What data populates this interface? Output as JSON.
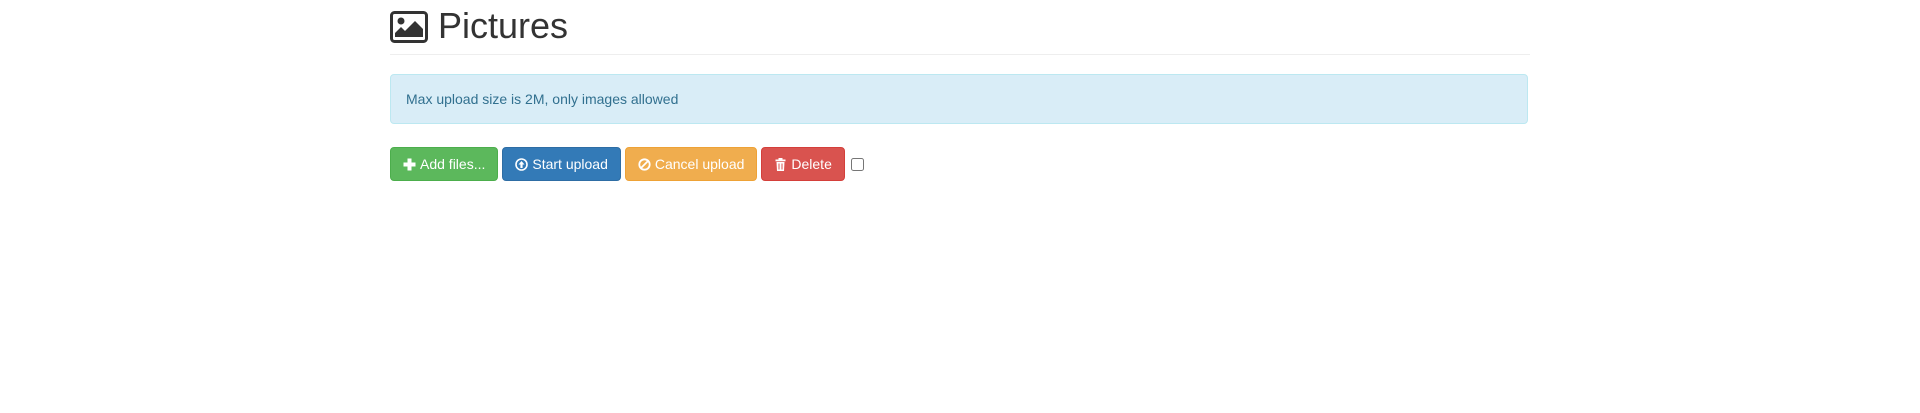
{
  "header": {
    "title": "Pictures",
    "icon": "picture-icon"
  },
  "alert": {
    "text": "Max upload size is 2M, only images allowed"
  },
  "toolbar": {
    "add_files_label": "Add files...",
    "start_upload_label": "Start upload",
    "cancel_upload_label": "Cancel upload",
    "delete_label": "Delete"
  },
  "colors": {
    "success": "#5cb85c",
    "primary": "#337ab7",
    "warning": "#f0ad4e",
    "danger": "#d9534f",
    "alert_bg": "#d9edf7",
    "alert_text": "#31708f"
  }
}
